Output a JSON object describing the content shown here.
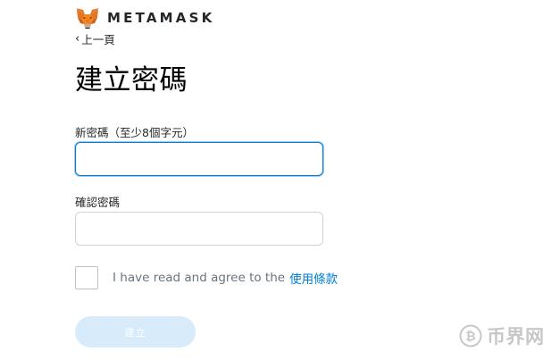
{
  "brand": {
    "logo_icon": "metamask-fox-icon",
    "name": "METAMASK"
  },
  "nav": {
    "back_label": "上一頁",
    "back_icon": "chevron-left-icon"
  },
  "page": {
    "title": "建立密碼"
  },
  "form": {
    "new_password": {
      "label": "新密碼（至少8個字元）",
      "value": "",
      "state": "focused"
    },
    "confirm_password": {
      "label": "確認密碼",
      "value": ""
    },
    "terms": {
      "checked": false,
      "text": "I have read and agree to the",
      "link_label": "使用條款"
    },
    "submit": {
      "label": "建立",
      "disabled": true
    }
  },
  "watermark": {
    "icon": "bitcoin-coin-icon",
    "text": "币界网"
  },
  "colors": {
    "accent": "#037dd6",
    "button_disabled_bg": "#d8ebfa",
    "text_primary": "#24272a",
    "text_secondary": "#6a737d"
  }
}
